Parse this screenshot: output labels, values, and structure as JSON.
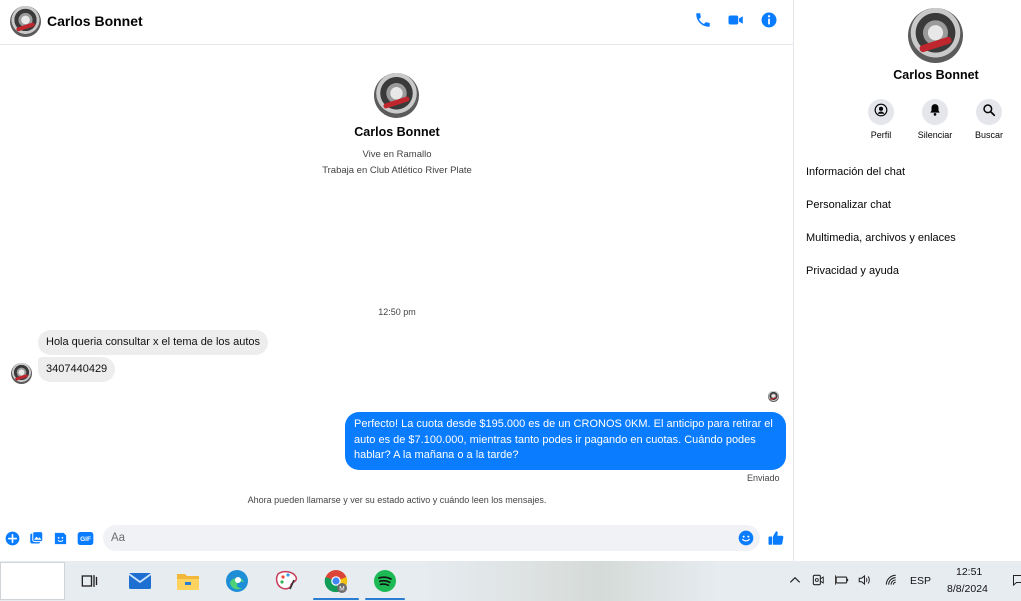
{
  "header": {
    "name": "Carlos Bonnet"
  },
  "intro": {
    "name": "Carlos Bonnet",
    "line1": "Vive en Ramallo",
    "line2": "Trabaja en Club Atlético River Plate"
  },
  "timestamp": "12:50 pm",
  "messages": [
    {
      "direction": "in",
      "text": "Hola queria consultar x el tema de los autos"
    },
    {
      "direction": "in",
      "text": "3407440429"
    },
    {
      "direction": "out",
      "text": "Perfecto! La cuota desde $195.000 es de un CRONOS 0KM. El anticipo para retirar el auto es de $7.100.000, mientras tanto podes ir pagando en cuotas. Cuándo podes hablar? A la mañana o a la tarde?"
    }
  ],
  "sent_label": "Enviado",
  "system_note": "Ahora pueden llamarse y ver su estado activo y cuándo leen los mensajes.",
  "composer": {
    "placeholder": "Aa",
    "gif_label": "GIF"
  },
  "info": {
    "name": "Carlos Bonnet",
    "actions": [
      {
        "label": "Perfil",
        "icon": "profile-icon"
      },
      {
        "label": "Silenciar",
        "icon": "bell-icon"
      },
      {
        "label": "Buscar",
        "icon": "search-icon"
      }
    ],
    "menu": [
      "Información del chat",
      "Personalizar chat",
      "Multimedia, archivos y enlaces",
      "Privacidad y ayuda"
    ]
  },
  "taskbar": {
    "apps": [
      "task-view-icon",
      "mail-icon",
      "file-explorer-icon",
      "edge-icon",
      "paint-icon",
      "chrome-icon",
      "spotify-icon"
    ],
    "language": "ESP",
    "time": "12:51",
    "date": "8/8/2024"
  },
  "colors": {
    "accent": "#0a7cff",
    "bubble_in": "#ededed",
    "taskbar": "#e7ecf1"
  }
}
